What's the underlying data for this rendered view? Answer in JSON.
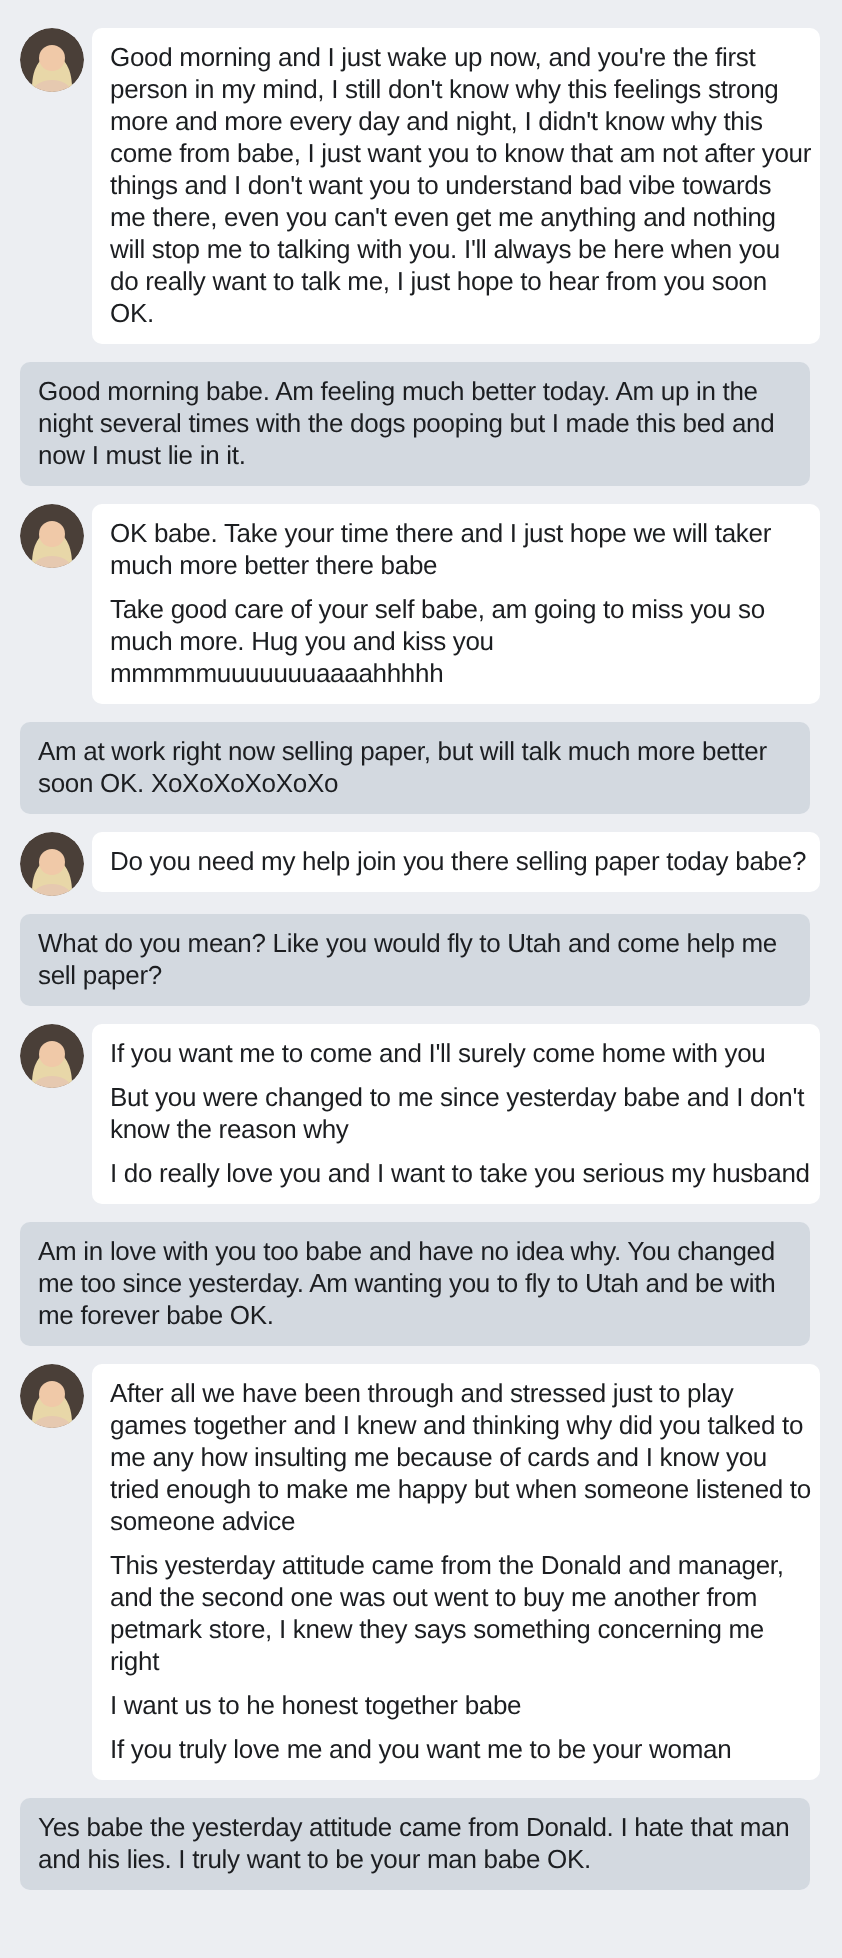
{
  "messages": [
    {
      "kind": "received",
      "paragraphs": [
        "Good morning and I just wake up now, and you're the first person in my mind, I still don't know why this feelings strong more and more every day and night, I didn't know why this come from babe, I just want you to know that am not after your things and I don't want you to understand bad vibe towards me there, even you can't even get me anything and nothing will stop me to talking with you. I'll always be here when you do really want to talk me, I just hope to hear from you soon OK."
      ]
    },
    {
      "kind": "sent",
      "paragraphs": [
        "Good morning babe. Am feeling much better today. Am up in the night several times with the dogs pooping but I made this bed and now I must lie in it."
      ]
    },
    {
      "kind": "received",
      "paragraphs": [
        "OK babe. Take your time there and I just hope we will taker much more better there babe",
        "Take good care of your self babe, am going to miss you so much more. Hug you and kiss you mmmmmuuuuuuuaaaahhhhh"
      ]
    },
    {
      "kind": "sent",
      "paragraphs": [
        "Am at work right now selling paper, but will talk much more better soon OK. XoXoXoXoXoXo"
      ]
    },
    {
      "kind": "received",
      "paragraphs": [
        "Do you need my help join you there selling paper today babe?"
      ]
    },
    {
      "kind": "sent",
      "paragraphs": [
        "What do you mean? Like you would fly to Utah and come help me sell paper?"
      ]
    },
    {
      "kind": "received",
      "paragraphs": [
        "If you want me to come and I'll surely come home with you",
        "But you were changed to me since yesterday babe and I don't know the reason why",
        "I do really love you and I want to take you serious my husband"
      ]
    },
    {
      "kind": "sent",
      "paragraphs": [
        "Am in love with you too babe and have no idea why. You changed me too since yesterday. Am wanting you to fly to Utah and be with me forever babe OK."
      ]
    },
    {
      "kind": "received",
      "paragraphs": [
        "After all we have been through and stressed just to play games together and I knew and thinking why did you talked to me any how insulting me because of cards and I know you tried enough to make me happy but when someone listened to someone advice",
        "This yesterday attitude came from the Donald and manager, and the second one was out went to buy me another from petmark store, I knew they says something concerning me right",
        "I want us to he honest together babe",
        "If you truly love me and you want me to be your woman"
      ]
    },
    {
      "kind": "sent",
      "paragraphs": [
        "Yes babe the yesterday attitude came from Donald. I hate that man and his lies. I truly want to be your man babe OK."
      ]
    }
  ]
}
